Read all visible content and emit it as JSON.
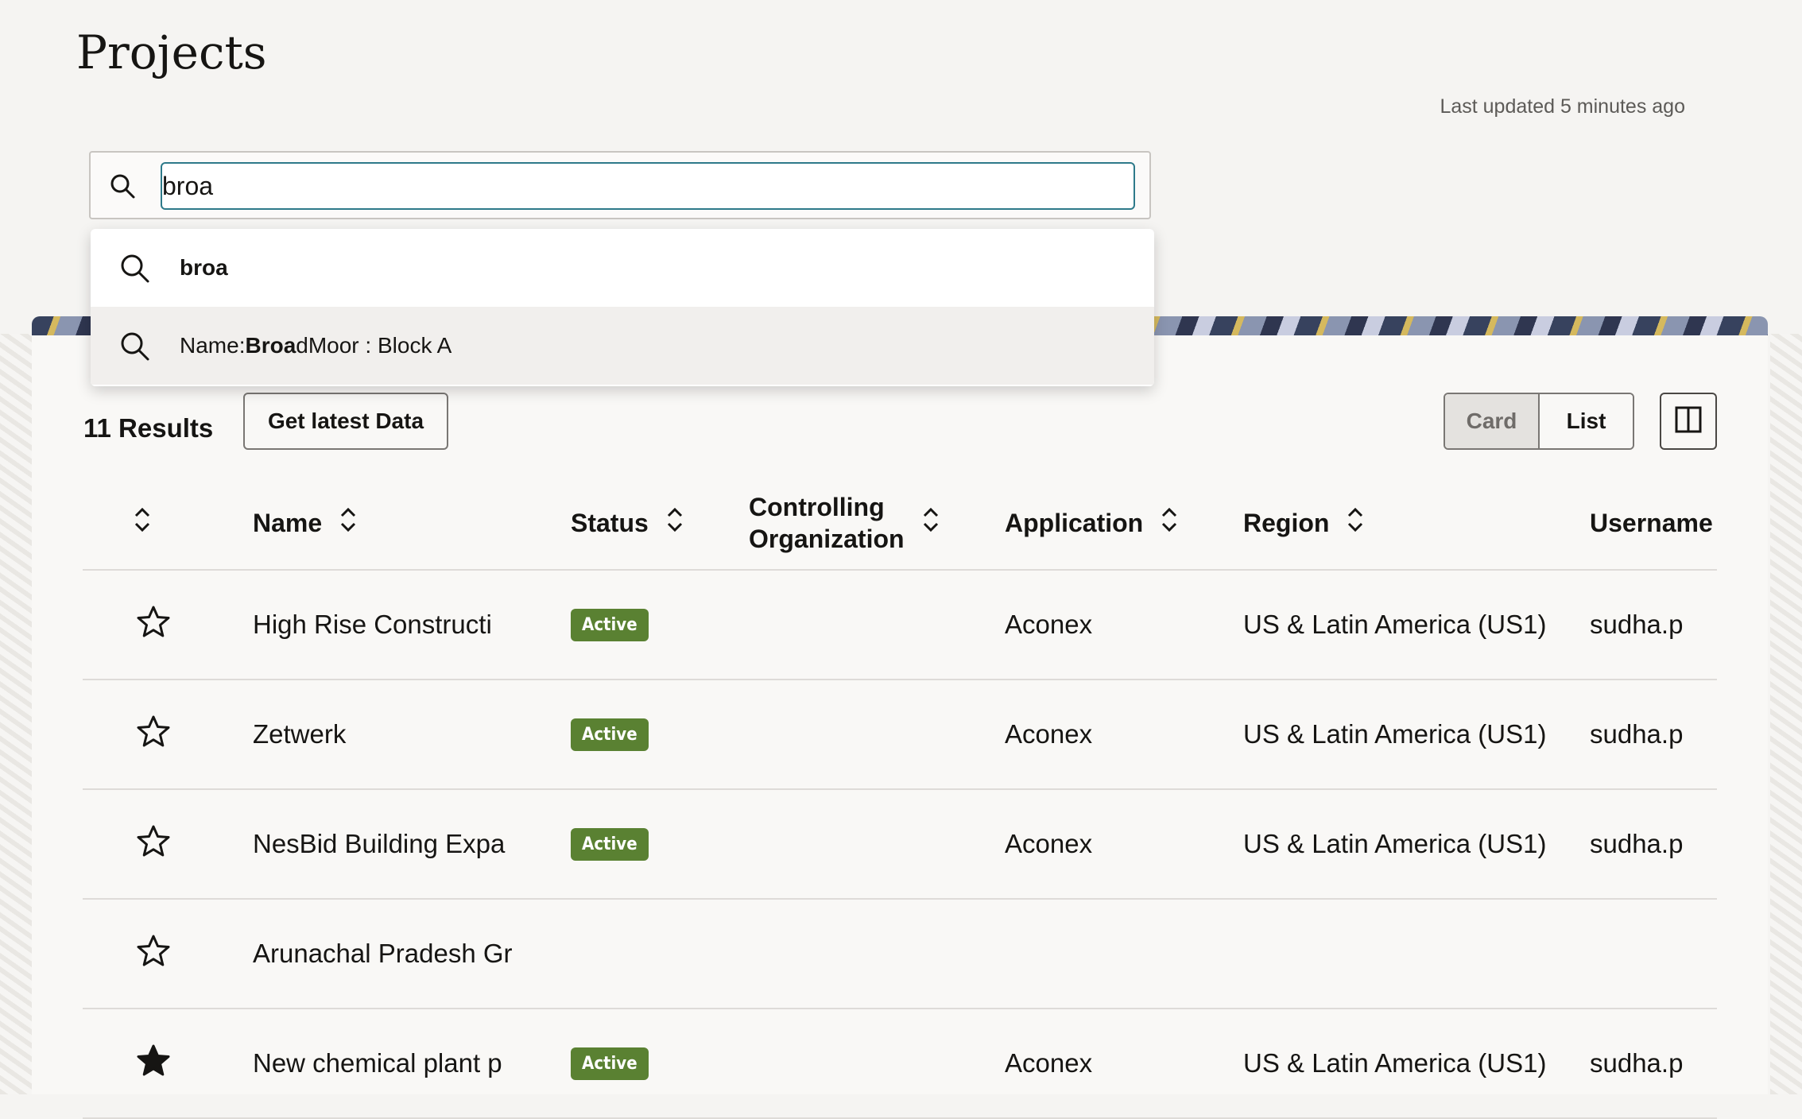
{
  "page": {
    "title": "Projects",
    "last_updated": "Last updated 5 minutes ago"
  },
  "search": {
    "value": "broa",
    "icon": "search-icon",
    "suggestions": [
      {
        "prefix": "",
        "match": "broa",
        "rest": ""
      },
      {
        "prefix": "Name:",
        "match": "Broa",
        "rest": "dMoor : Block A"
      }
    ]
  },
  "toolbar": {
    "results": "11 Results",
    "get_latest": "Get latest Data",
    "view_card": "Card",
    "view_list": "List"
  },
  "table": {
    "columns": {
      "name": "Name",
      "status": "Status",
      "org_line1": "Controlling",
      "org_line2": "Organization",
      "application": "Application",
      "region": "Region",
      "username": "Username"
    },
    "rows": [
      {
        "favorite": false,
        "name": "High Rise Constructi",
        "status": "Active",
        "application": "Aconex",
        "region": "US & Latin America (US1)",
        "username": "sudha.p"
      },
      {
        "favorite": false,
        "name": "Zetwerk",
        "status": "Active",
        "application": "Aconex",
        "region": "US & Latin America (US1)",
        "username": "sudha.p"
      },
      {
        "favorite": false,
        "name": "NesBid Building Expa",
        "status": "Active",
        "application": "Aconex",
        "region": "US & Latin America (US1)",
        "username": "sudha.p"
      },
      {
        "favorite": false,
        "name": "Arunachal Pradesh Gr",
        "status": "",
        "application": "",
        "region": "",
        "username": ""
      },
      {
        "favorite": true,
        "name": "New chemical plant p",
        "status": "Active",
        "application": "Aconex",
        "region": "US & Latin America (US1)",
        "username": "sudha.p"
      }
    ]
  },
  "colors": {
    "active_badge": "#5a8132",
    "focus_border": "#2e7a8a"
  }
}
